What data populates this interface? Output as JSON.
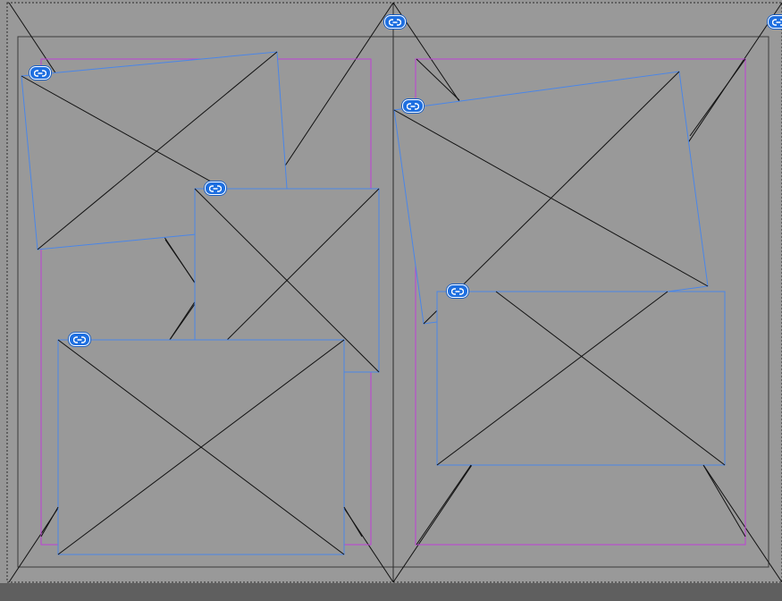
{
  "colors": {
    "app_background": "#5f5f5f",
    "pasteboard": "#969696",
    "spread_page": "#999999",
    "bleed_guide": "#3a3a3a",
    "margin_guide": "#c040d8",
    "frame_selection": "#4a86e8",
    "placeholder_cross": "#111111",
    "link_badge": "#1e6fe0"
  },
  "spread": {
    "pages": [
      "left-page",
      "right-page"
    ],
    "frames": [
      {
        "id": "left-top-tilted",
        "page": "left",
        "type": "empty-image-frame",
        "rotated": true,
        "linked": true
      },
      {
        "id": "left-middle",
        "page": "left",
        "type": "empty-image-frame",
        "rotated": false,
        "linked": true
      },
      {
        "id": "left-bottom",
        "page": "left",
        "type": "empty-image-frame",
        "rotated": false,
        "linked": true
      },
      {
        "id": "right-top-tilted",
        "page": "right",
        "type": "empty-image-frame",
        "rotated": true,
        "linked": true
      },
      {
        "id": "right-bottom",
        "page": "right",
        "type": "empty-image-frame",
        "rotated": false,
        "linked": true
      },
      {
        "id": "spread-background-left",
        "page": "left",
        "type": "empty-image-frame",
        "rotated": false,
        "linked": true
      },
      {
        "id": "spread-background-right",
        "page": "right",
        "type": "empty-image-frame",
        "rotated": false,
        "linked": true
      }
    ]
  },
  "icons": {
    "link_badge": "chain-link-icon"
  }
}
